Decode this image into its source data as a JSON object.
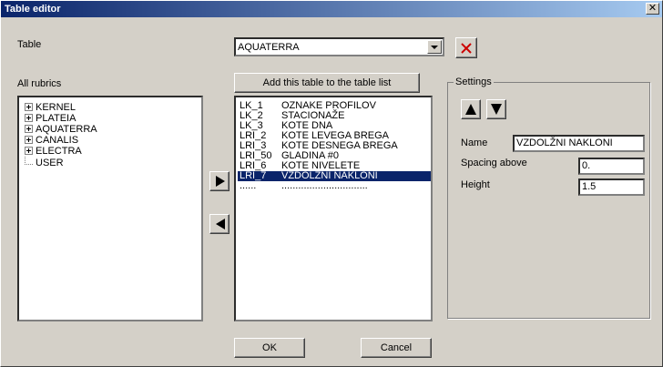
{
  "window": {
    "title": "Table editor"
  },
  "table_label": "Table",
  "table_combo": {
    "value": "AQUATERRA"
  },
  "all_rubrics_label": "All rubrics",
  "rubrics": [
    {
      "label": "KERNEL",
      "expandable": true
    },
    {
      "label": "PLATEIA",
      "expandable": true
    },
    {
      "label": "AQUATERRA",
      "expandable": true
    },
    {
      "label": "CANALIS",
      "expandable": true
    },
    {
      "label": "ELECTRA",
      "expandable": true
    },
    {
      "label": "USER",
      "expandable": false
    }
  ],
  "add_button_label": "Add this table to the table list",
  "table_list": [
    {
      "code": "LK_1",
      "name": "OZNAKE PROFILOV"
    },
    {
      "code": "LK_2",
      "name": "STACIONAŽE"
    },
    {
      "code": "LK_3",
      "name": "KOTE DNA"
    },
    {
      "code": "LRI_2",
      "name": "KOTE LEVEGA BREGA"
    },
    {
      "code": "LRI_3",
      "name": "KOTE DESNEGA BREGA"
    },
    {
      "code": "LRI_50",
      "name": "GLADINA #0"
    },
    {
      "code": "LRI_6",
      "name": "KOTE NIVELETE"
    },
    {
      "code": "LRI_7",
      "name": "VZDOLŽNI NAKLONI",
      "selected": true
    },
    {
      "code": "......",
      "name": "..............................."
    }
  ],
  "settings": {
    "title": "Settings",
    "name_label": "Name",
    "name_value": "VZDOLŽNI NAKLONI",
    "spacing_label": "Spacing above",
    "spacing_value": "0.",
    "height_label": "Height",
    "height_value": "1.5"
  },
  "ok_label": "OK",
  "cancel_label": "Cancel",
  "colors": {
    "selection": "#0a246a",
    "delete_icon": "#cc0000",
    "title_gradient_start": "#0a246a"
  }
}
